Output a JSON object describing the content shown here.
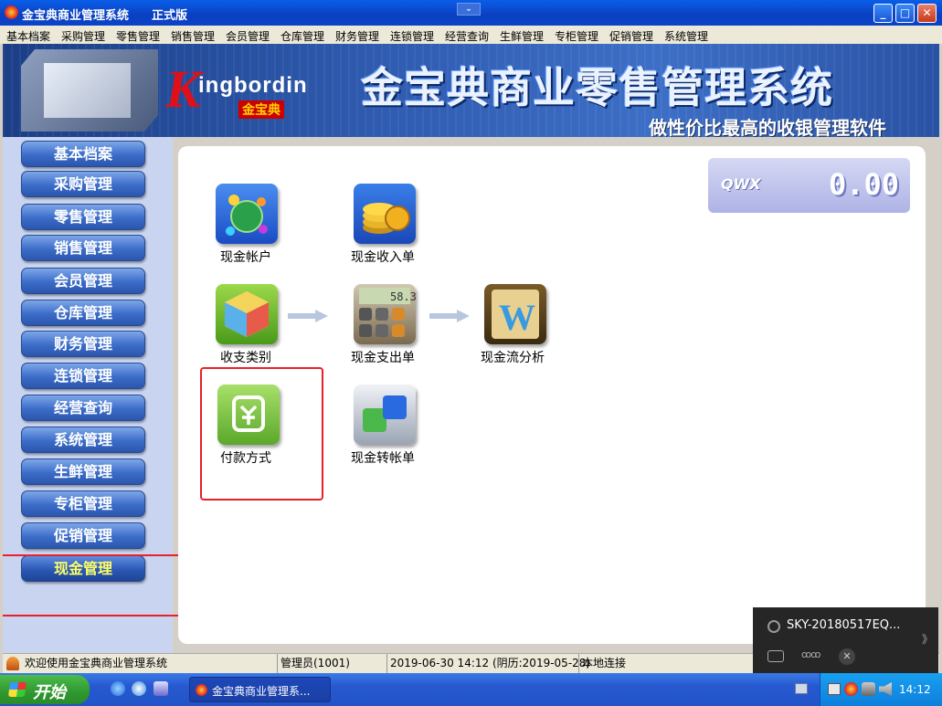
{
  "window": {
    "title": "金宝典商业管理系统",
    "edition": "正式版"
  },
  "window_controls": {
    "minimize": "_",
    "maximize": "□",
    "close": "✕"
  },
  "menubar": [
    "基本档案",
    "采购管理",
    "零售管理",
    "销售管理",
    "会员管理",
    "仓库管理",
    "财务管理",
    "连锁管理",
    "经营查询",
    "生鲜管理",
    "专柜管理",
    "促销管理",
    "系统管理"
  ],
  "banner": {
    "logo_k": "K",
    "logo_word": "ingbordin",
    "logo_cn": "金宝典",
    "title": "金宝典商业零售管理系统",
    "slogan": "做性价比最高的收银管理软件"
  },
  "sidebar": {
    "items": [
      {
        "label": "基本档案"
      },
      {
        "label": "采购管理"
      },
      {
        "label": "零售管理"
      },
      {
        "label": "销售管理"
      },
      {
        "label": "会员管理"
      },
      {
        "label": "仓库管理"
      },
      {
        "label": "财务管理"
      },
      {
        "label": "连锁管理"
      },
      {
        "label": "经营查询"
      },
      {
        "label": "系统管理"
      },
      {
        "label": "生鲜管理"
      },
      {
        "label": "专柜管理"
      },
      {
        "label": "促销管理"
      },
      {
        "label": "现金管理"
      }
    ],
    "active": "现金管理"
  },
  "counter": {
    "brand": "QWX",
    "value": "0.00"
  },
  "tiles": [
    {
      "label": "现金帐户",
      "icon": "globe-network-icon"
    },
    {
      "label": "现金收入单",
      "icon": "coins-icon"
    },
    {
      "label": "收支类别",
      "icon": "cube-icon"
    },
    {
      "label": "现金支出单",
      "icon": "calculator-icon"
    },
    {
      "label": "现金流分析",
      "icon": "w-book-icon"
    },
    {
      "label": "付款方式",
      "icon": "payment-icon"
    },
    {
      "label": "现金转帐单",
      "icon": "transfer-squares-icon"
    }
  ],
  "status": {
    "welcome": "欢迎使用金宝典商业管理系统",
    "operator": "管理员(1001)",
    "datetime": "2019-06-30 14:12 (阴历:2019-05-28)",
    "connection": "本地连接"
  },
  "taskbar": {
    "start": "开始",
    "task": "金宝典商业管理系...",
    "clock": "14:12"
  },
  "popup": {
    "name": "SKY-20180517EQ...",
    "chevron": "》",
    "group": "ꝏꝏ",
    "close": "✕"
  },
  "colors": {
    "highlight": "#e8202a",
    "active_nav_text": "#ffff66",
    "nav_button": "#3b6cc8"
  }
}
